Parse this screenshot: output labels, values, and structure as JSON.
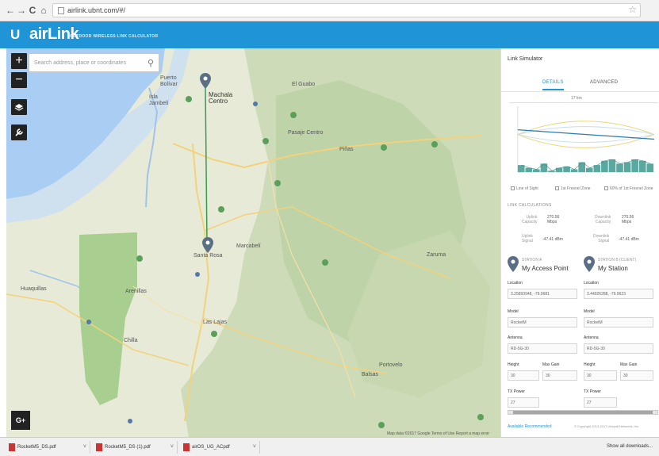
{
  "browser": {
    "url": "airlink.ubnt.com/#/",
    "back_icon": "←",
    "forward_icon": "→",
    "reload_icon": "C",
    "home_icon": "⌂",
    "star_icon": "☆"
  },
  "app": {
    "logo": "U",
    "name": "airLink",
    "tagline": "OUTDOOR WIRELESS LINK CALCULATOR",
    "accent": "#1f95d8"
  },
  "map": {
    "search_placeholder": "Search address, place or coordinates",
    "zoom_in": "+",
    "zoom_out": "−",
    "station_a_name": "Machala\nCentro",
    "station_b_name": "Santa Rosa",
    "labels": [
      {
        "text": "Puerto\nBolívar"
      },
      {
        "text": "Isla\nJambelí"
      },
      {
        "text": "El Guabo"
      },
      {
        "text": "Pasaje Centro"
      },
      {
        "text": "Piñas"
      },
      {
        "text": "Arenillas"
      },
      {
        "text": "Huaquillas"
      },
      {
        "text": "Las Lajas"
      },
      {
        "text": "Zaruma"
      },
      {
        "text": "Balsas"
      },
      {
        "text": "Portovelo"
      },
      {
        "text": "Chilla"
      },
      {
        "text": "Marcabelí"
      }
    ],
    "footer": "Map data ©2017 Google   Terms of Use   Report a map error",
    "street_view_label": "G+"
  },
  "panel": {
    "title": "Link Simulator",
    "tabs": [
      "DETAILS",
      "ADVANCED"
    ],
    "active_tab": 0,
    "distance": "17 km",
    "legend": [
      "Line of Sight",
      "1st Fresnel Zone",
      "60% of 1st Fresnel Zone"
    ],
    "section_label": "LINK CALCULATIONS",
    "metrics": [
      {
        "label": "Uplink\nCapacity",
        "value": "270.56\nMbps"
      },
      {
        "label": "Downlink\nCapacity",
        "value": "270.56\nMbps"
      },
      {
        "label": "Uplink\nSignal",
        "value": "-47.41 dBm"
      },
      {
        "label": "Downlink\nSignal",
        "value": "-47.41 dBm"
      }
    ],
    "station_a": {
      "label": "STATION A",
      "name": "My Access Point",
      "location": "3.25893948, -79.9681"
    },
    "station_b": {
      "label": "STATION B (CLIENT)",
      "name": "My Station",
      "location": "3.44926288, -79.9623"
    },
    "fields": {
      "location": "Location",
      "model": "Model",
      "model_value": "RocketM",
      "antenna": "Antenna",
      "antenna_value": "RD-5G-30",
      "height": "Height",
      "height_value": "30",
      "max_gain": "Max Gain",
      "max_gain_value": "30",
      "tx_power": "TX Power",
      "tx_power_value": "27"
    },
    "footer_link": "Available Recommended",
    "footer_copy": "© Copyright 2013-2017 Ubiquiti Networks, Inc."
  },
  "downloads": {
    "items": [
      "RocketM5_DS.pdf",
      "RocketM5_DS (1).pdf",
      "airOS_UG_ACpdf"
    ],
    "show_all": "Show all downloads..."
  },
  "chart_data": {
    "type": "area",
    "title": "",
    "x": [
      0,
      1,
      2,
      3,
      4,
      5,
      6,
      7,
      8,
      9,
      10,
      11,
      12,
      13,
      14,
      15,
      16,
      17
    ],
    "series": [
      {
        "values": [
          5,
          3,
          2,
          6,
          1,
          3,
          4,
          2,
          7,
          3,
          5,
          8,
          9,
          6,
          7,
          9,
          8,
          6
        ]
      }
    ]
  }
}
